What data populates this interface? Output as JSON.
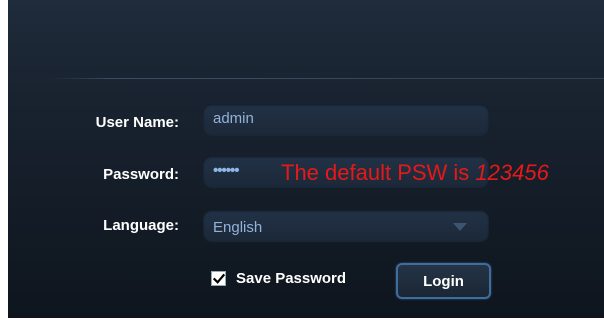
{
  "form": {
    "username": {
      "label": "User Name:",
      "value": "admin"
    },
    "password": {
      "label": "Password:",
      "masked_value": "••••••"
    },
    "hint": {
      "text": "The default PSW is ",
      "code": "123456"
    },
    "language": {
      "label": "Language:",
      "selected": "English"
    },
    "save_password": {
      "label": "Save Password",
      "checked": true
    },
    "login_label": "Login"
  },
  "colors": {
    "panel_bg": "#1a2432",
    "field_bg": "#1f2e40",
    "field_text": "#93b2d8",
    "hint_red": "#e61919",
    "button_border": "#3f6d9e"
  },
  "icons": {
    "dropdown": "chevron-down-icon",
    "checkbox": "checkmark-icon"
  }
}
